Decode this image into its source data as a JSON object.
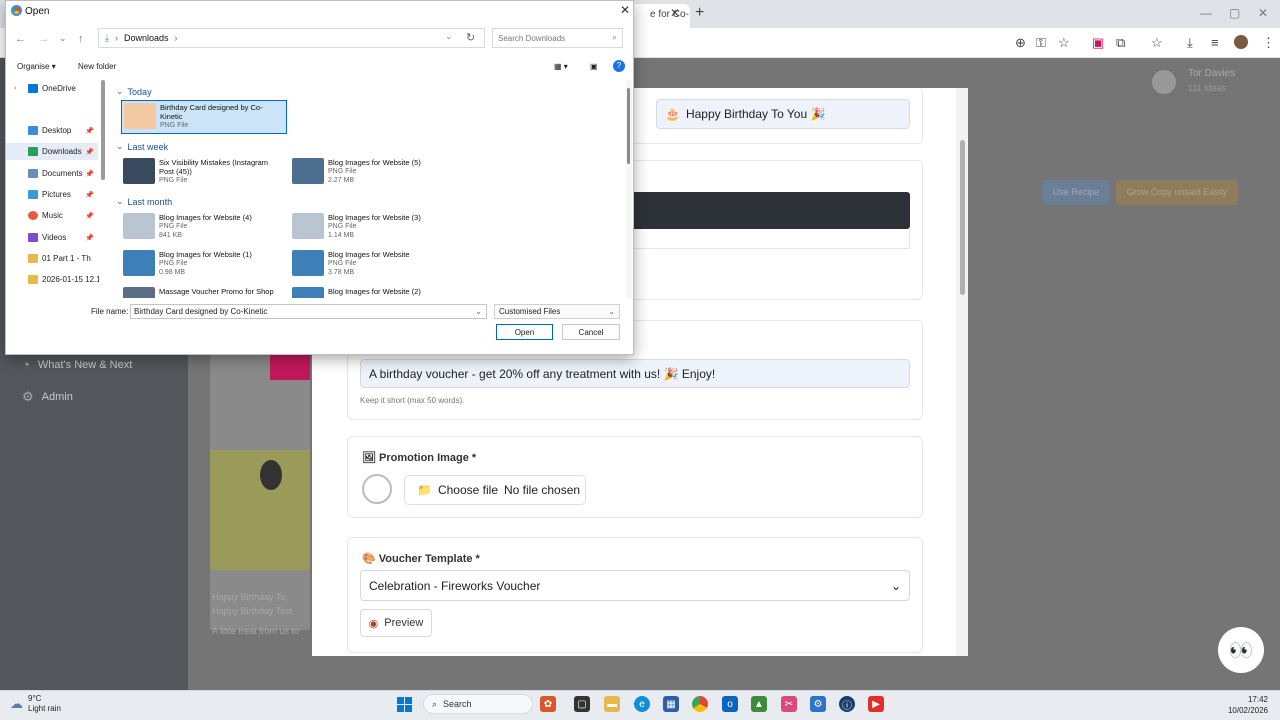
{
  "browser": {
    "tab_title": "e for Co-",
    "new_tab": "+",
    "win_min": "—",
    "win_max": "▢",
    "win_close": "✕"
  },
  "app": {
    "profile_name": "Tor Davies",
    "profile_sub": "111 Ideas",
    "sidebar": [
      {
        "label": "What's New & Next",
        "icon": "megaphone-icon"
      },
      {
        "label": "Admin",
        "icon": "gear-icon"
      }
    ],
    "btn_recipe": "Use Recipe",
    "btn_copy": "Grow Copy unsaid Easily",
    "promo_title": "Happy Birthday To",
    "promo_sub": "Happy Birthday Test",
    "promo_desc": "A little treat from us to",
    "modal": {
      "promo_name_value": "Happy Birthday To You 🎉",
      "promo_name_emoji": "🎂",
      "description_value": "A birthday voucher - get 20% off any treatment with us! 🎉 Enjoy!",
      "description_hint": "Keep it short (max 50 words).",
      "image_label": "Promotion Image *",
      "choose_file": "Choose file",
      "no_file": "No file chosen",
      "template_label": "Voucher Template *",
      "template_value": "Celebration - Fireworks Voucher",
      "preview_label": "Preview"
    }
  },
  "dialog": {
    "title": "Open",
    "address": "Downloads",
    "search_placeholder": "Search Downloads",
    "organise": "Organise",
    "new_folder": "New folder",
    "nav": [
      {
        "label": "OneDrive",
        "color": "#0078d4",
        "pinned": false
      },
      {
        "label": "Desktop",
        "color": "#3b8fd9",
        "pinned": true
      },
      {
        "label": "Downloads",
        "color": "#2a9d5c",
        "pinned": true
      },
      {
        "label": "Documents",
        "color": "#6b8fb3",
        "pinned": true
      },
      {
        "label": "Pictures",
        "color": "#3a9ad9",
        "pinned": true
      },
      {
        "label": "Music",
        "color": "#e35d3b",
        "pinned": true
      },
      {
        "label": "Videos",
        "color": "#7a4fc9",
        "pinned": true
      },
      {
        "label": "01 Part 1 - Th",
        "color": "#e8b84a",
        "pinned": false
      },
      {
        "label": "2026-01-15 12.1",
        "color": "#e8b84a",
        "pinned": false
      }
    ],
    "groups": [
      "Today",
      "Last week",
      "Last month"
    ],
    "files": [
      {
        "name": "Birthday Card designed by Co-Kinetic",
        "type": "PNG File",
        "size": "",
        "color": "#f2c9a0"
      },
      {
        "name": "Six Visibility Mistakes (Instagram Post (45))",
        "type": "PNG File",
        "size": "",
        "color": "#3a4a5e"
      },
      {
        "name": "Blog Images for Website (5)",
        "type": "PNG File",
        "size": "2.27 MB",
        "color": "#4c6f8f"
      },
      {
        "name": "Blog Images for Website (4)",
        "type": "PNG File",
        "size": "841 KB",
        "color": "#b9c6d2"
      },
      {
        "name": "Blog Images for Website (3)",
        "type": "PNG File",
        "size": "1.14 MB",
        "color": "#b9c6d2"
      },
      {
        "name": "Blog Images for Website (1)",
        "type": "PNG File",
        "size": "0.98 MB",
        "color": "#3f7fb8"
      },
      {
        "name": "Blog Images for Website",
        "type": "PNG File",
        "size": "3.78 MB",
        "color": "#3f7fb8"
      },
      {
        "name": "Massage Voucher Promo for Shop",
        "type": "",
        "size": "",
        "color": "#5a6f86"
      },
      {
        "name": "Blog Images for Website (2)",
        "type": "",
        "size": "",
        "color": "#3f7fb8"
      }
    ],
    "file_name_label": "File name:",
    "file_name_value": "Birthday Card designed by Co-Kinetic",
    "file_type": "Customised Files",
    "open_label": "Open",
    "cancel_label": "Cancel"
  },
  "taskbar": {
    "temp": "9°C",
    "weather": "Light rain",
    "search": "Search",
    "time": "17:42",
    "date": "10/02/2026"
  }
}
